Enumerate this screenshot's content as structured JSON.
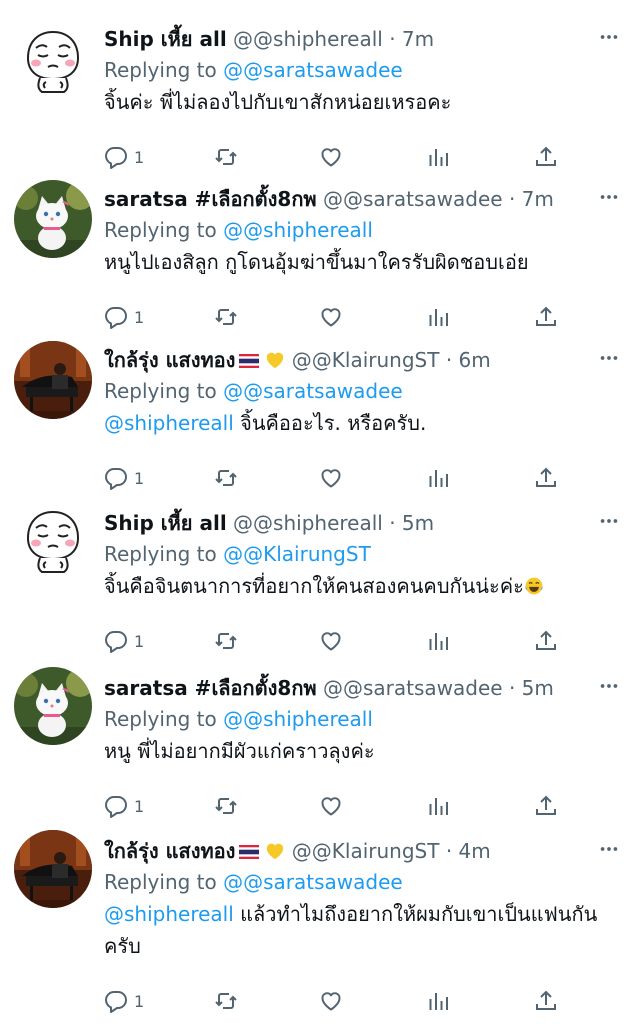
{
  "tweets": [
    {
      "name": "Ship เหี้ย all",
      "handle": "@@shiphereall",
      "time": "· 7m",
      "replying_prefix": "Replying to ",
      "replying_to": "@@saratsawadee",
      "text": "จิ้นค่ะ พี่ไม่ลองไปกับเขาสักหน่อยเหรอคะ",
      "reply_count": "1",
      "avatar_icon": "sticker-face-icon"
    },
    {
      "name": "saratsa #เลือกตั้ง8กพ",
      "handle": "@@saratsawadee",
      "time": "· 7m",
      "replying_prefix": "Replying to ",
      "replying_to": "@@shiphereall",
      "text": "หนูไปเองสิลูก กูโดนอุ้มฆ่าขึ้นมาใครรับผิดชอบเอ่ย",
      "reply_count": "1",
      "avatar_icon": "white-cat-icon"
    },
    {
      "name": "ใกล้รุ่ง แสงทอง",
      "handle": "@@KlairungST",
      "time": "· 6m",
      "replying_prefix": "Replying to ",
      "replying_to": "@@saratsawadee",
      "mention": "@shiphereall",
      "text": " จิ้นคืออะไร. หรือครับ.",
      "reply_count": "1",
      "avatar_icon": "piano-photo-icon"
    },
    {
      "name": "Ship เหี้ย all",
      "handle": "@@shiphereall",
      "time": "· 5m",
      "replying_prefix": "Replying to ",
      "replying_to": "@@KlairungST",
      "text": "จิ้นคือจินตนาการที่อยากให้คนสองคนคบกันน่ะค่ะ",
      "reply_count": "1",
      "avatar_icon": "sticker-face-icon"
    },
    {
      "name": "saratsa #เลือกตั้ง8กพ",
      "handle": "@@saratsawadee",
      "time": "· 5m",
      "replying_prefix": "Replying to ",
      "replying_to": "@@shiphereall",
      "text": "หนู พี่ไม่อยากมีผัวแก่คราวลุงค่ะ",
      "reply_count": "1",
      "avatar_icon": "white-cat-icon"
    },
    {
      "name": "ใกล้รุ่ง แสงทอง",
      "handle": "@@KlairungST",
      "time": "· 4m",
      "replying_prefix": "Replying to ",
      "replying_to": "@@saratsawadee",
      "mention": "@shiphereall",
      "text": " แล้วทำไมถึงอยากให้ผมกับเขาเป็นแฟนกัน ครับ",
      "reply_count": "1",
      "avatar_icon": "piano-photo-icon"
    }
  ],
  "icons": {
    "more": "more-horizontal-icon",
    "reply": "reply-bubble-icon",
    "retweet": "retweet-icon",
    "like": "heart-icon",
    "analytics": "analytics-bars-icon",
    "share": "share-upload-icon",
    "flag": "thailand-flag-icon",
    "heart_emoji": "yellow-heart-icon",
    "laugh_emoji": "tears-of-joy-icon"
  },
  "colors": {
    "text": "#0f1419",
    "muted": "#536471",
    "link": "#1d9bf0",
    "flag_red": "#e0243a",
    "flag_blue": "#2d2a6e",
    "heart_yellow": "#f7c928"
  }
}
